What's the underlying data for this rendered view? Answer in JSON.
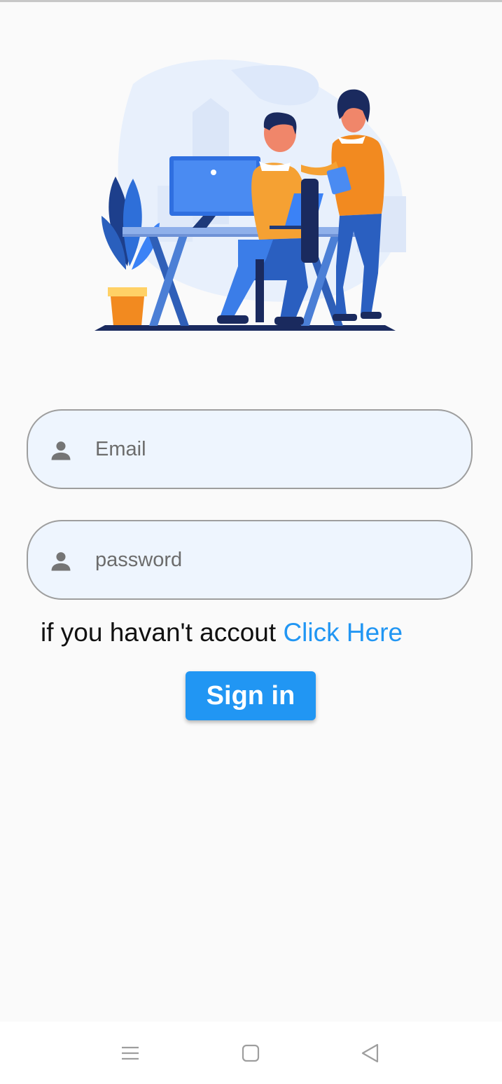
{
  "login": {
    "email_placeholder": "Email",
    "password_placeholder": "password",
    "signup_prompt": "if you havan't accout",
    "signup_link": "Click Here",
    "signin_label": "Sign in"
  },
  "icons": {
    "email": "person-icon",
    "password": "person-icon",
    "nav": [
      "menu-icon",
      "home-square-icon",
      "back-triangle-icon"
    ]
  },
  "colors": {
    "accent": "#2196f3",
    "field_background": "#eef5fe",
    "field_border": "#9e9e9e",
    "page_background": "#fafafa"
  }
}
